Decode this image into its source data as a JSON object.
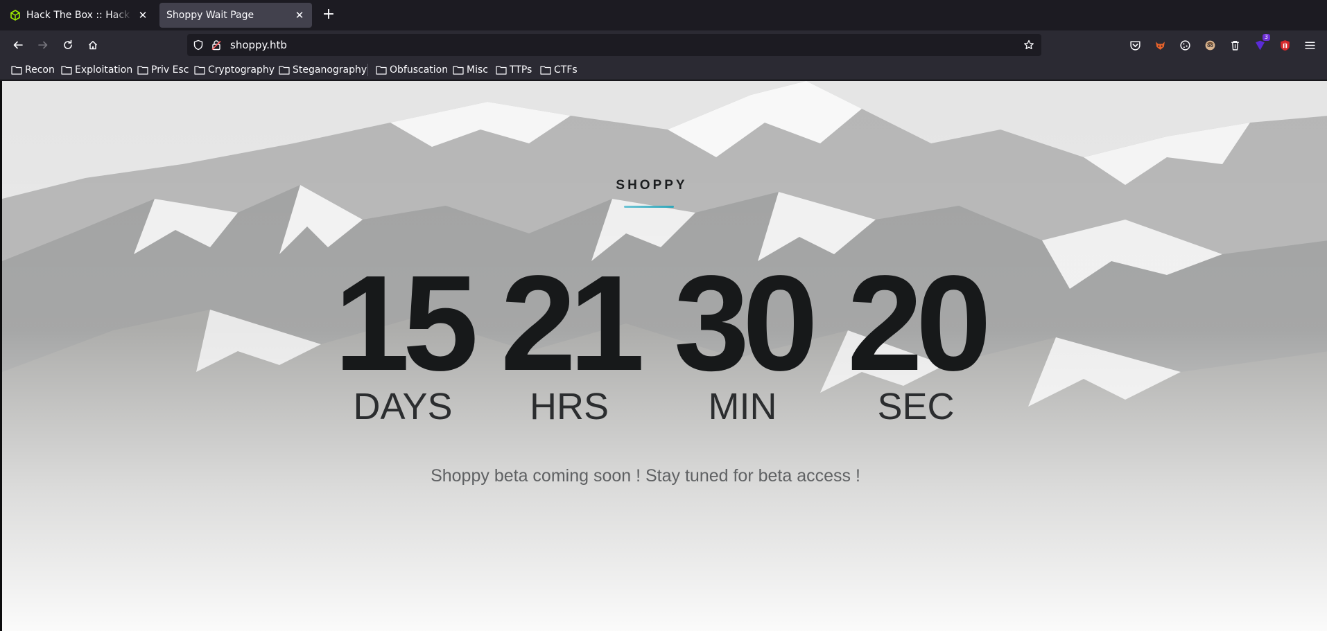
{
  "browser": {
    "tabs": [
      {
        "title": "Hack The Box :: Hack The Box",
        "active": false,
        "favicon": "htb-cube-icon"
      },
      {
        "title": "Shoppy Wait Page",
        "active": true
      }
    ],
    "new_tab_label": "+",
    "close_glyph": "✕",
    "url": "shoppy.htb",
    "extensions": [
      {
        "name": "pocket-icon"
      },
      {
        "name": "foxyproxy-icon"
      },
      {
        "name": "cookie-icon"
      },
      {
        "name": "avatar-icon"
      },
      {
        "name": "trash-icon"
      },
      {
        "name": "extension-badge-icon",
        "badge": "3"
      },
      {
        "name": "ublock-hand-icon"
      },
      {
        "name": "menu-icon"
      }
    ]
  },
  "bookmarks": [
    "Recon",
    "Exploitation",
    "Priv Esc",
    "Cryptography",
    "Steganography",
    "Obfuscation",
    "Misc",
    "TTPs",
    "CTFs"
  ],
  "page": {
    "brand": "SHOPPY",
    "accent_color": "#2fa6b9",
    "countdown": [
      {
        "value": "15",
        "label": "DAYS"
      },
      {
        "value": "21",
        "label": "HRS"
      },
      {
        "value": "30",
        "label": "MIN"
      },
      {
        "value": "20",
        "label": "SEC"
      }
    ],
    "tagline": "Shoppy beta coming soon ! Stay tuned for beta access !"
  }
}
